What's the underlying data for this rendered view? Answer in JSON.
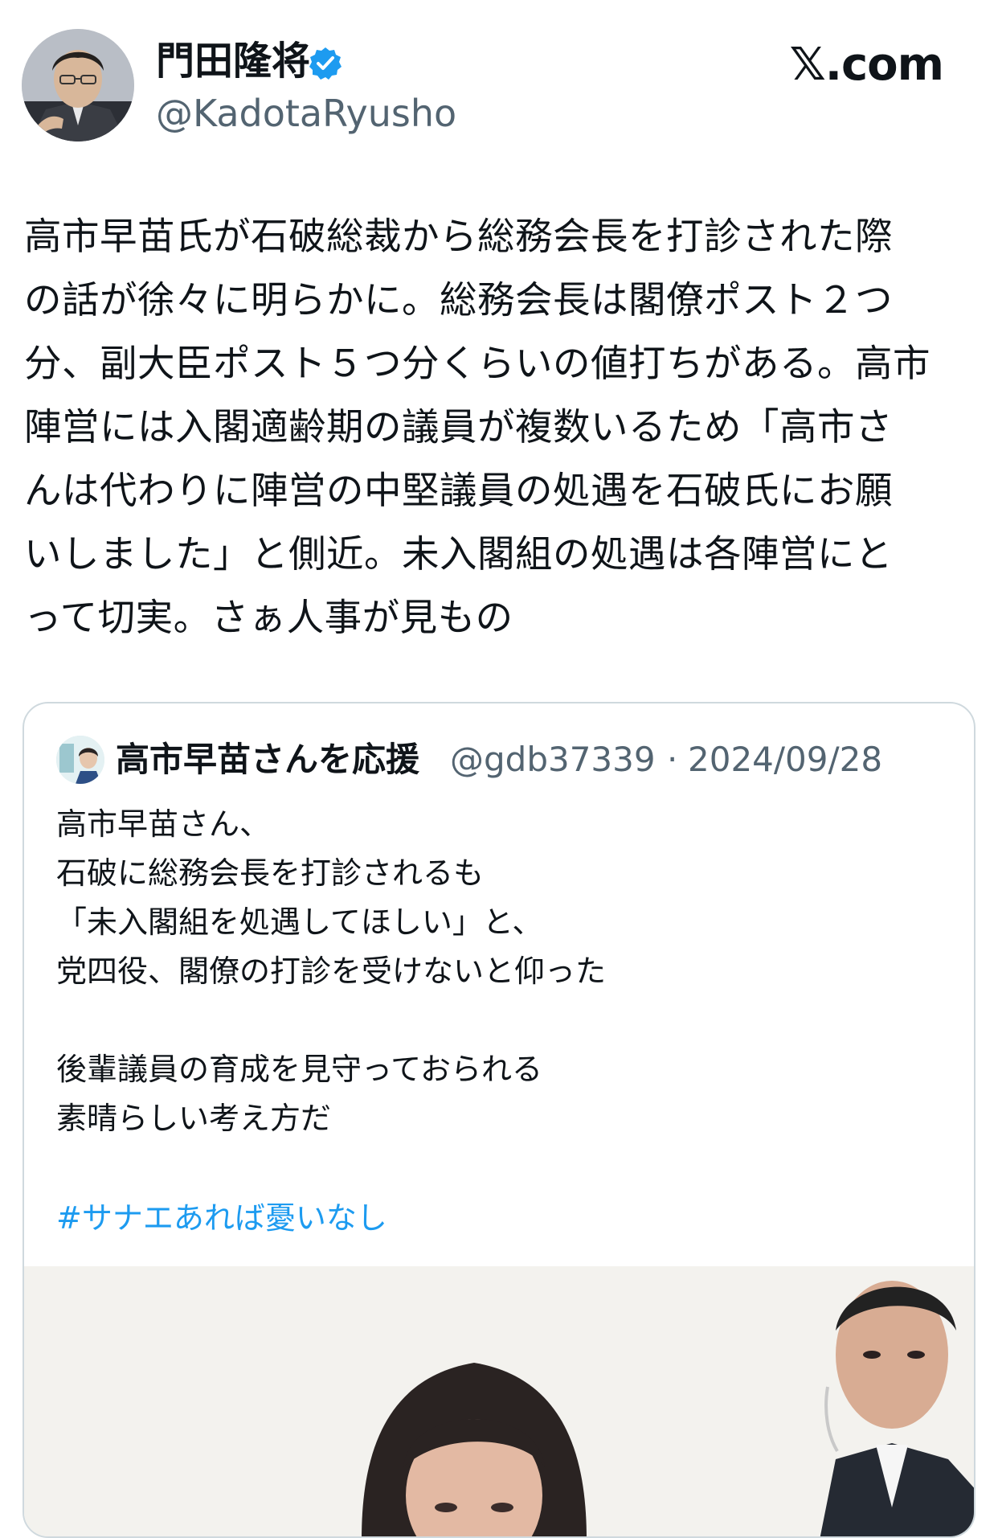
{
  "author": {
    "display_name": "門田隆将",
    "handle": "@KadotaRyusho",
    "verified": true,
    "avatar_icon": "person-avatar-icon",
    "badge_icon": "verified-badge-icon"
  },
  "site_logo": "𝕏.com",
  "post": {
    "text": "高市早苗氏が石破総裁から総務会長を打診された際\nの話が徐々に明らかに。総務会長は閣僚ポスト２つ\n分、副大臣ポスト５つ分くらいの値打ちがある。高市\n陣営には入閣適齢期の議員が複数いるため「高市さ\nんは代わりに陣営の中堅議員の処遇を石破氏にお願\nいしました」と側近。未入閣組の処遇は各陣営にと\nって切実。さぁ人事が見もの"
  },
  "quote": {
    "display_name": "高市早苗さんを応援",
    "handle": "@gdb37339",
    "separator": "·",
    "date": "2024/09/28",
    "text": "高市早苗さん、\n石破に総務会長を打診されるも\n「未入閣組を処遇してほしい」と、\n党四役、閣僚の打診を受けないと仰った\n\n後輩議員の育成を見守っておられる\n素晴らしい考え方だ",
    "hashtag": "#サナエあれば憂いなし",
    "accent_color": "#1d9bf0"
  },
  "colors": {
    "text": "#0f1419",
    "secondary": "#536471",
    "border": "#cfd9de",
    "verified": "#1d9bf0"
  }
}
